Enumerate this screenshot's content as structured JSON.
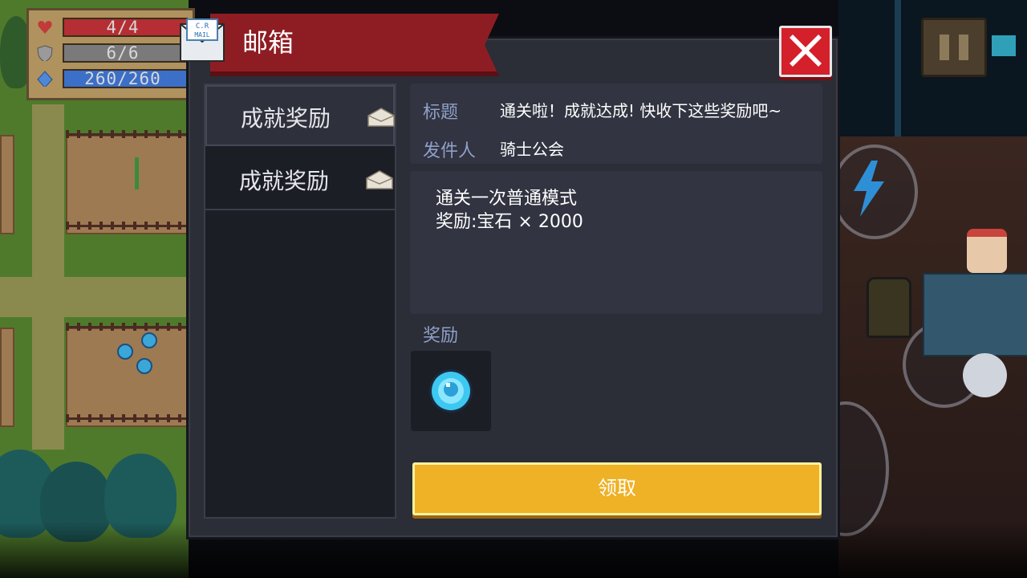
{
  "hud": {
    "health": "4/4",
    "armor": "6/6",
    "energy": "260/260",
    "health_fill": 1.0,
    "armor_fill": 1.0,
    "energy_fill": 1.0,
    "colors": {
      "health": "#b52e34",
      "armor": "#7a7a7a",
      "energy": "#3c6fc8"
    }
  },
  "mail_icon_text": [
    "C.R",
    "MAIL"
  ],
  "dialog": {
    "title": "邮箱",
    "close_icon": "close-x-icon"
  },
  "mail_list": {
    "items": [
      {
        "label": "成就奖励",
        "icon": "envelope-opened-icon",
        "selected": true
      },
      {
        "label": "成就奖励",
        "icon": "envelope-opened-icon",
        "selected": false
      }
    ]
  },
  "mail_detail": {
    "subject_label": "标题",
    "subject_value": "通关啦！成就达成! 快收下这些奖励吧~",
    "sender_label": "发件人",
    "sender_value": "骑士公会",
    "content_lines": [
      "通关一次普通模式",
      "奖励:宝石 × 2000"
    ],
    "reward_label": "奖励",
    "reward_icon": "gem-icon",
    "claim_label": "领取"
  },
  "colors": {
    "ribbon": "#8e1d23",
    "close_button": "#d3202b",
    "claim_button": "#efb125",
    "label_blue": "#8fa0c8"
  }
}
